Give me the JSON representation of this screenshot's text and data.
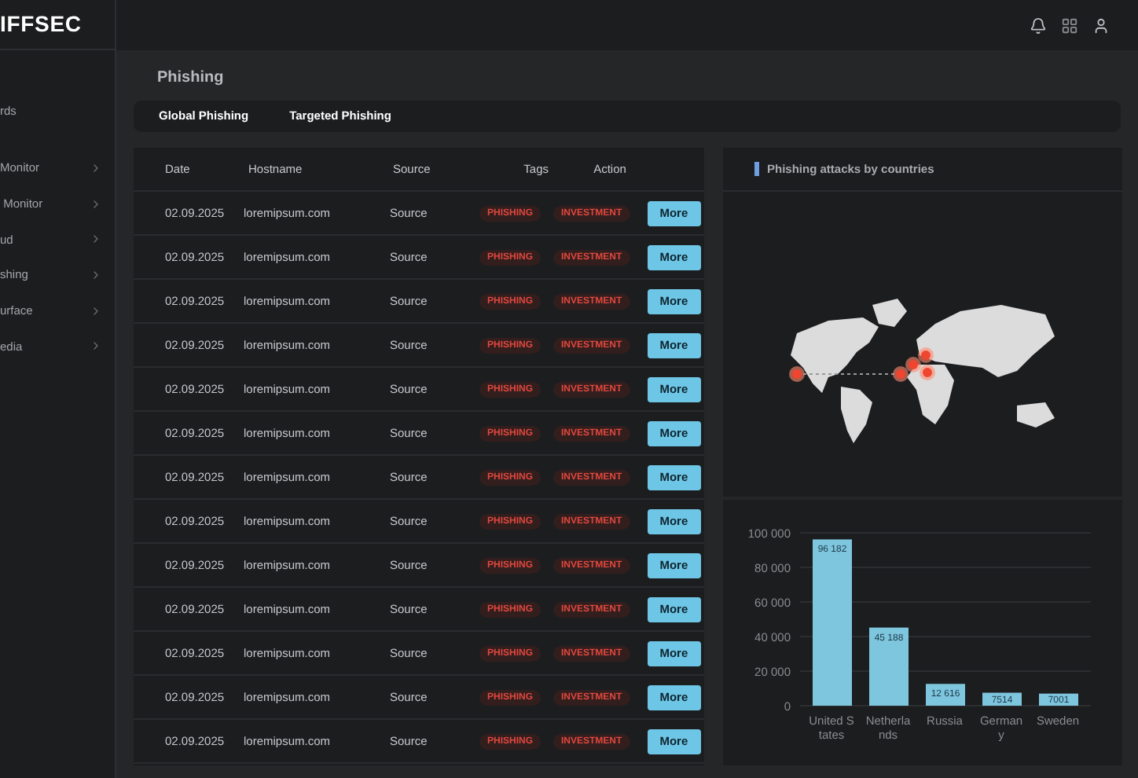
{
  "logo": "IFFSEC",
  "sidebar": {
    "items": [
      {
        "label": "rds",
        "expandable": false
      },
      {
        "label": "Monitor",
        "expandable": true
      },
      {
        "label": " Monitor",
        "expandable": true
      },
      {
        "label": "ud",
        "expandable": true
      },
      {
        "label": "shing",
        "expandable": true
      },
      {
        "label": "urface",
        "expandable": true
      },
      {
        "label": "edia",
        "expandable": true
      }
    ]
  },
  "page_title": "Phishing",
  "tabs": [
    {
      "label": "Global Phishing"
    },
    {
      "label": "Targeted Phishing"
    }
  ],
  "table": {
    "columns": [
      "Date",
      "Hostname",
      "Source",
      "Tags",
      "Action"
    ],
    "rows": [
      {
        "date": "02.09.2025",
        "hostname": "loremipsum.com",
        "source": "Source",
        "tags": [
          "PHISHING",
          "INVESTMENT"
        ],
        "action": "More"
      },
      {
        "date": "02.09.2025",
        "hostname": "loremipsum.com",
        "source": "Source",
        "tags": [
          "PHISHING",
          "INVESTMENT"
        ],
        "action": "More"
      },
      {
        "date": "02.09.2025",
        "hostname": "loremipsum.com",
        "source": "Source",
        "tags": [
          "PHISHING",
          "INVESTMENT"
        ],
        "action": "More"
      },
      {
        "date": "02.09.2025",
        "hostname": "loremipsum.com",
        "source": "Source",
        "tags": [
          "PHISHING",
          "INVESTMENT"
        ],
        "action": "More"
      },
      {
        "date": "02.09.2025",
        "hostname": "loremipsum.com",
        "source": "Source",
        "tags": [
          "PHISHING",
          "INVESTMENT"
        ],
        "action": "More"
      },
      {
        "date": "02.09.2025",
        "hostname": "loremipsum.com",
        "source": "Source",
        "tags": [
          "PHISHING",
          "INVESTMENT"
        ],
        "action": "More"
      },
      {
        "date": "02.09.2025",
        "hostname": "loremipsum.com",
        "source": "Source",
        "tags": [
          "PHISHING",
          "INVESTMENT"
        ],
        "action": "More"
      },
      {
        "date": "02.09.2025",
        "hostname": "loremipsum.com",
        "source": "Source",
        "tags": [
          "PHISHING",
          "INVESTMENT"
        ],
        "action": "More"
      },
      {
        "date": "02.09.2025",
        "hostname": "loremipsum.com",
        "source": "Source",
        "tags": [
          "PHISHING",
          "INVESTMENT"
        ],
        "action": "More"
      },
      {
        "date": "02.09.2025",
        "hostname": "loremipsum.com",
        "source": "Source",
        "tags": [
          "PHISHING",
          "INVESTMENT"
        ],
        "action": "More"
      },
      {
        "date": "02.09.2025",
        "hostname": "loremipsum.com",
        "source": "Source",
        "tags": [
          "PHISHING",
          "INVESTMENT"
        ],
        "action": "More"
      },
      {
        "date": "02.09.2025",
        "hostname": "loremipsum.com",
        "source": "Source",
        "tags": [
          "PHISHING",
          "INVESTMENT"
        ],
        "action": "More"
      },
      {
        "date": "02.09.2025",
        "hostname": "loremipsum.com",
        "source": "Source",
        "tags": [
          "PHISHING",
          "INVESTMENT"
        ],
        "action": "More"
      }
    ]
  },
  "map_panel": {
    "title": "Phishing attacks by countries"
  },
  "chart_panel": {
    "chart_data": {
      "type": "bar",
      "categories": [
        "United States",
        "Netherlands",
        "Russia",
        "Germany",
        "Sweden"
      ],
      "series": [
        {
          "color": "#7ec6de",
          "values": [
            96182,
            45188,
            12616,
            7514,
            7001
          ]
        }
      ],
      "grid": true,
      "ylim": [
        0,
        100000
      ],
      "yticks": [
        {
          "value": 0,
          "label": "0"
        },
        {
          "value": 20000,
          "label": "20 000"
        },
        {
          "value": 40000,
          "label": "40 000"
        },
        {
          "value": 60000,
          "label": "60 000"
        },
        {
          "value": 80000,
          "label": "80 000"
        },
        {
          "value": 100000,
          "label": "100 000"
        }
      ],
      "value_labels": [
        "96 182",
        "45 188",
        "12 616",
        "7514",
        "7001"
      ]
    }
  }
}
